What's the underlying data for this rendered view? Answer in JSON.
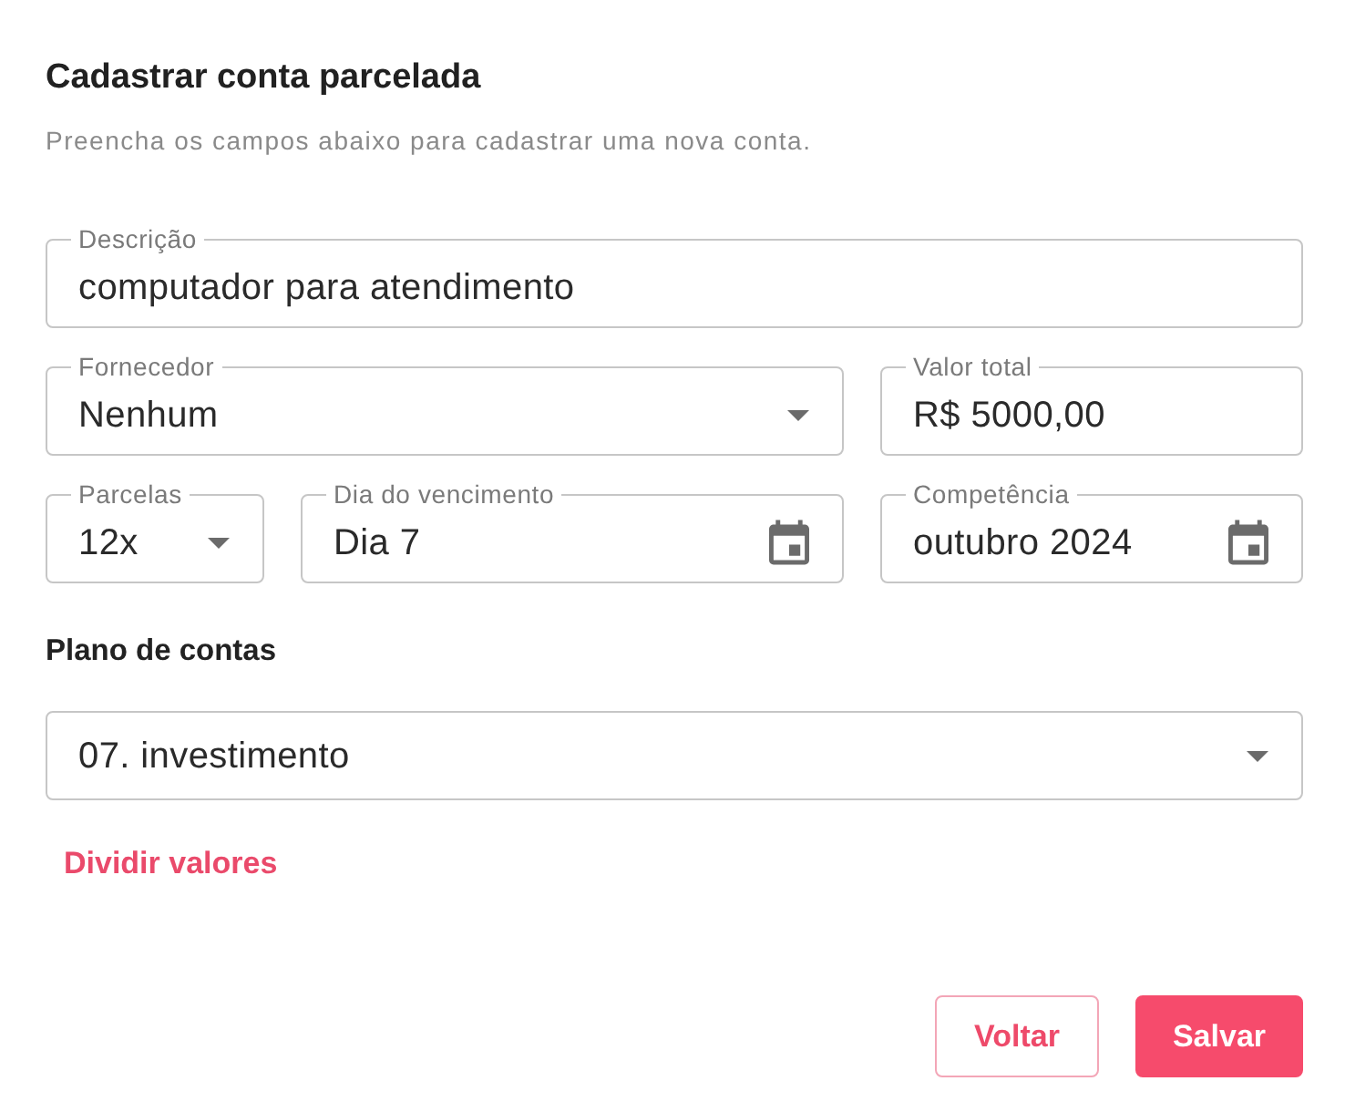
{
  "dialog": {
    "title": "Cadastrar conta parcelada",
    "subtitle": "Preencha os campos abaixo para cadastrar uma nova conta."
  },
  "field_rows": [
    [
      {
        "kind": "text",
        "label": "Descrição",
        "value": "computador para atendimento"
      }
    ],
    [
      {
        "kind": "select",
        "label": "Fornecedor",
        "value": "Nenhum"
      },
      {
        "kind": "text",
        "label": "Valor total",
        "value": "R$ 5000,00"
      }
    ],
    [
      {
        "kind": "select",
        "label": "Parcelas",
        "value": "12x"
      },
      {
        "kind": "date",
        "label": "Dia do vencimento",
        "value": "Dia 7"
      },
      {
        "kind": "date",
        "label": "Competência",
        "value": "outubro 2024"
      }
    ]
  ],
  "account_plan": {
    "title": "Plano de contas",
    "select": {
      "kind": "select",
      "value": "07. investimento"
    }
  },
  "split_link": "Dividir valores",
  "buttons": [
    {
      "kind": "outline",
      "label": "Voltar"
    },
    {
      "kind": "primary",
      "label": "Salvar"
    }
  ]
}
